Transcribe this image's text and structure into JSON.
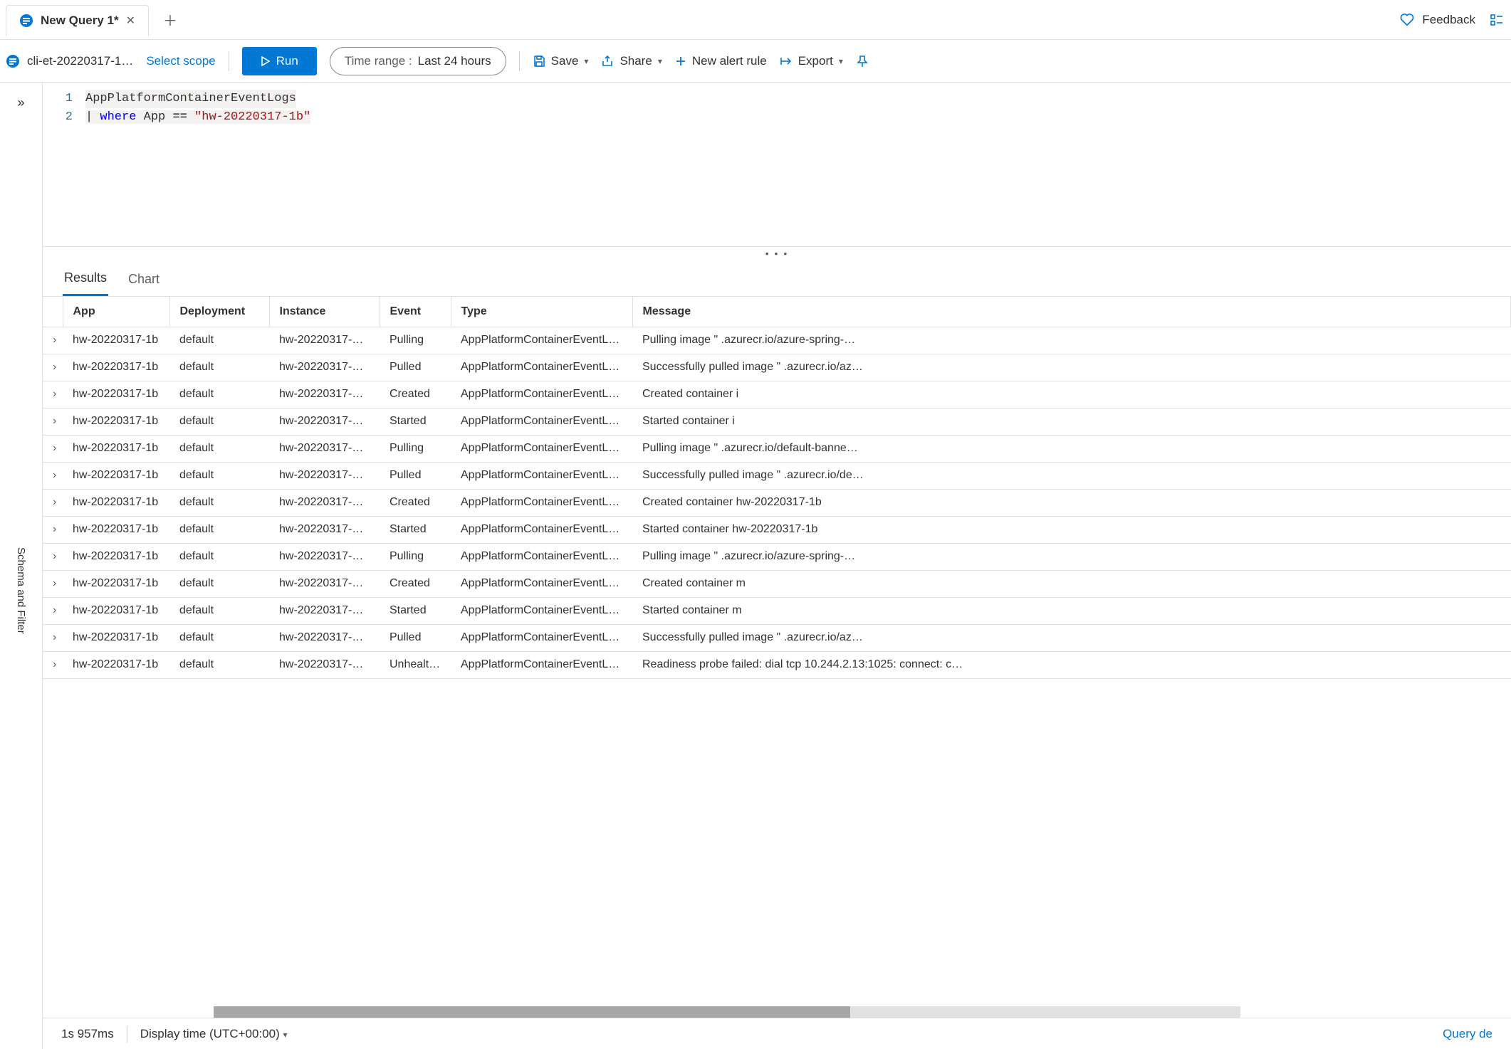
{
  "tab": {
    "title": "New Query 1*"
  },
  "header": {
    "feedback": "Feedback"
  },
  "toolbar": {
    "workspace": "cli-et-20220317-1…",
    "scope": "Select scope",
    "run": "Run",
    "timerange_label": "Time range :",
    "timerange_value": "Last 24 hours",
    "save": "Save",
    "share": "Share",
    "new_alert": "New alert rule",
    "export": "Export"
  },
  "editor": {
    "lines": [
      "1",
      "2"
    ],
    "code1": "AppPlatformContainerEventLogs",
    "code2_pipe": "|",
    "code2_kw": "where",
    "code2_field": "App",
    "code2_op": "==",
    "code2_str": "\"hw-20220317-1b\""
  },
  "side": {
    "schema": "Schema and Filter"
  },
  "results": {
    "tabs": {
      "results": "Results",
      "chart": "Chart"
    },
    "columns": [
      "App",
      "Deployment",
      "Instance",
      "Event",
      "Type",
      "Message"
    ],
    "rows": [
      {
        "app": "hw-20220317-1b",
        "dep": "default",
        "inst": "hw-20220317-1…",
        "event": "Pulling",
        "type": "AppPlatformContainerEventLogs",
        "msg": "Pulling image \"                                    .azurecr.io/azure-spring-…"
      },
      {
        "app": "hw-20220317-1b",
        "dep": "default",
        "inst": "hw-20220317-1…",
        "event": "Pulled",
        "type": "AppPlatformContainerEventLogs",
        "msg": "Successfully pulled image \"                                     .azurecr.io/az…"
      },
      {
        "app": "hw-20220317-1b",
        "dep": "default",
        "inst": "hw-20220317-1…",
        "event": "Created",
        "type": "AppPlatformContainerEventLogs",
        "msg": "Created container i"
      },
      {
        "app": "hw-20220317-1b",
        "dep": "default",
        "inst": "hw-20220317-1…",
        "event": "Started",
        "type": "AppPlatformContainerEventLogs",
        "msg": "Started container i"
      },
      {
        "app": "hw-20220317-1b",
        "dep": "default",
        "inst": "hw-20220317-1…",
        "event": "Pulling",
        "type": "AppPlatformContainerEventLogs",
        "msg": "Pulling image \"                                    .azurecr.io/default-banne…"
      },
      {
        "app": "hw-20220317-1b",
        "dep": "default",
        "inst": "hw-20220317-1…",
        "event": "Pulled",
        "type": "AppPlatformContainerEventLogs",
        "msg": "Successfully pulled image \"                                     .azurecr.io/de…"
      },
      {
        "app": "hw-20220317-1b",
        "dep": "default",
        "inst": "hw-20220317-1…",
        "event": "Created",
        "type": "AppPlatformContainerEventLogs",
        "msg": "Created container hw-20220317-1b"
      },
      {
        "app": "hw-20220317-1b",
        "dep": "default",
        "inst": "hw-20220317-1…",
        "event": "Started",
        "type": "AppPlatformContainerEventLogs",
        "msg": "Started container hw-20220317-1b"
      },
      {
        "app": "hw-20220317-1b",
        "dep": "default",
        "inst": "hw-20220317-1…",
        "event": "Pulling",
        "type": "AppPlatformContainerEventLogs",
        "msg": "Pulling image \"                                    .azurecr.io/azure-spring-…"
      },
      {
        "app": "hw-20220317-1b",
        "dep": "default",
        "inst": "hw-20220317-1…",
        "event": "Created",
        "type": "AppPlatformContainerEventLogs",
        "msg": "Created container m"
      },
      {
        "app": "hw-20220317-1b",
        "dep": "default",
        "inst": "hw-20220317-1…",
        "event": "Started",
        "type": "AppPlatformContainerEventLogs",
        "msg": "Started container m"
      },
      {
        "app": "hw-20220317-1b",
        "dep": "default",
        "inst": "hw-20220317-1…",
        "event": "Pulled",
        "type": "AppPlatformContainerEventLogs",
        "msg": "Successfully pulled image \"                                     .azurecr.io/az…"
      },
      {
        "app": "hw-20220317-1b",
        "dep": "default",
        "inst": "hw-20220317-1…",
        "event": "Unhealthy",
        "type": "AppPlatformContainerEventLogs",
        "msg": "Readiness probe failed: dial tcp 10.244.2.13:1025: connect: c…"
      }
    ]
  },
  "status": {
    "time": "1s 957ms",
    "display_time": "Display time (UTC+00:00)",
    "query_details": "Query de"
  }
}
